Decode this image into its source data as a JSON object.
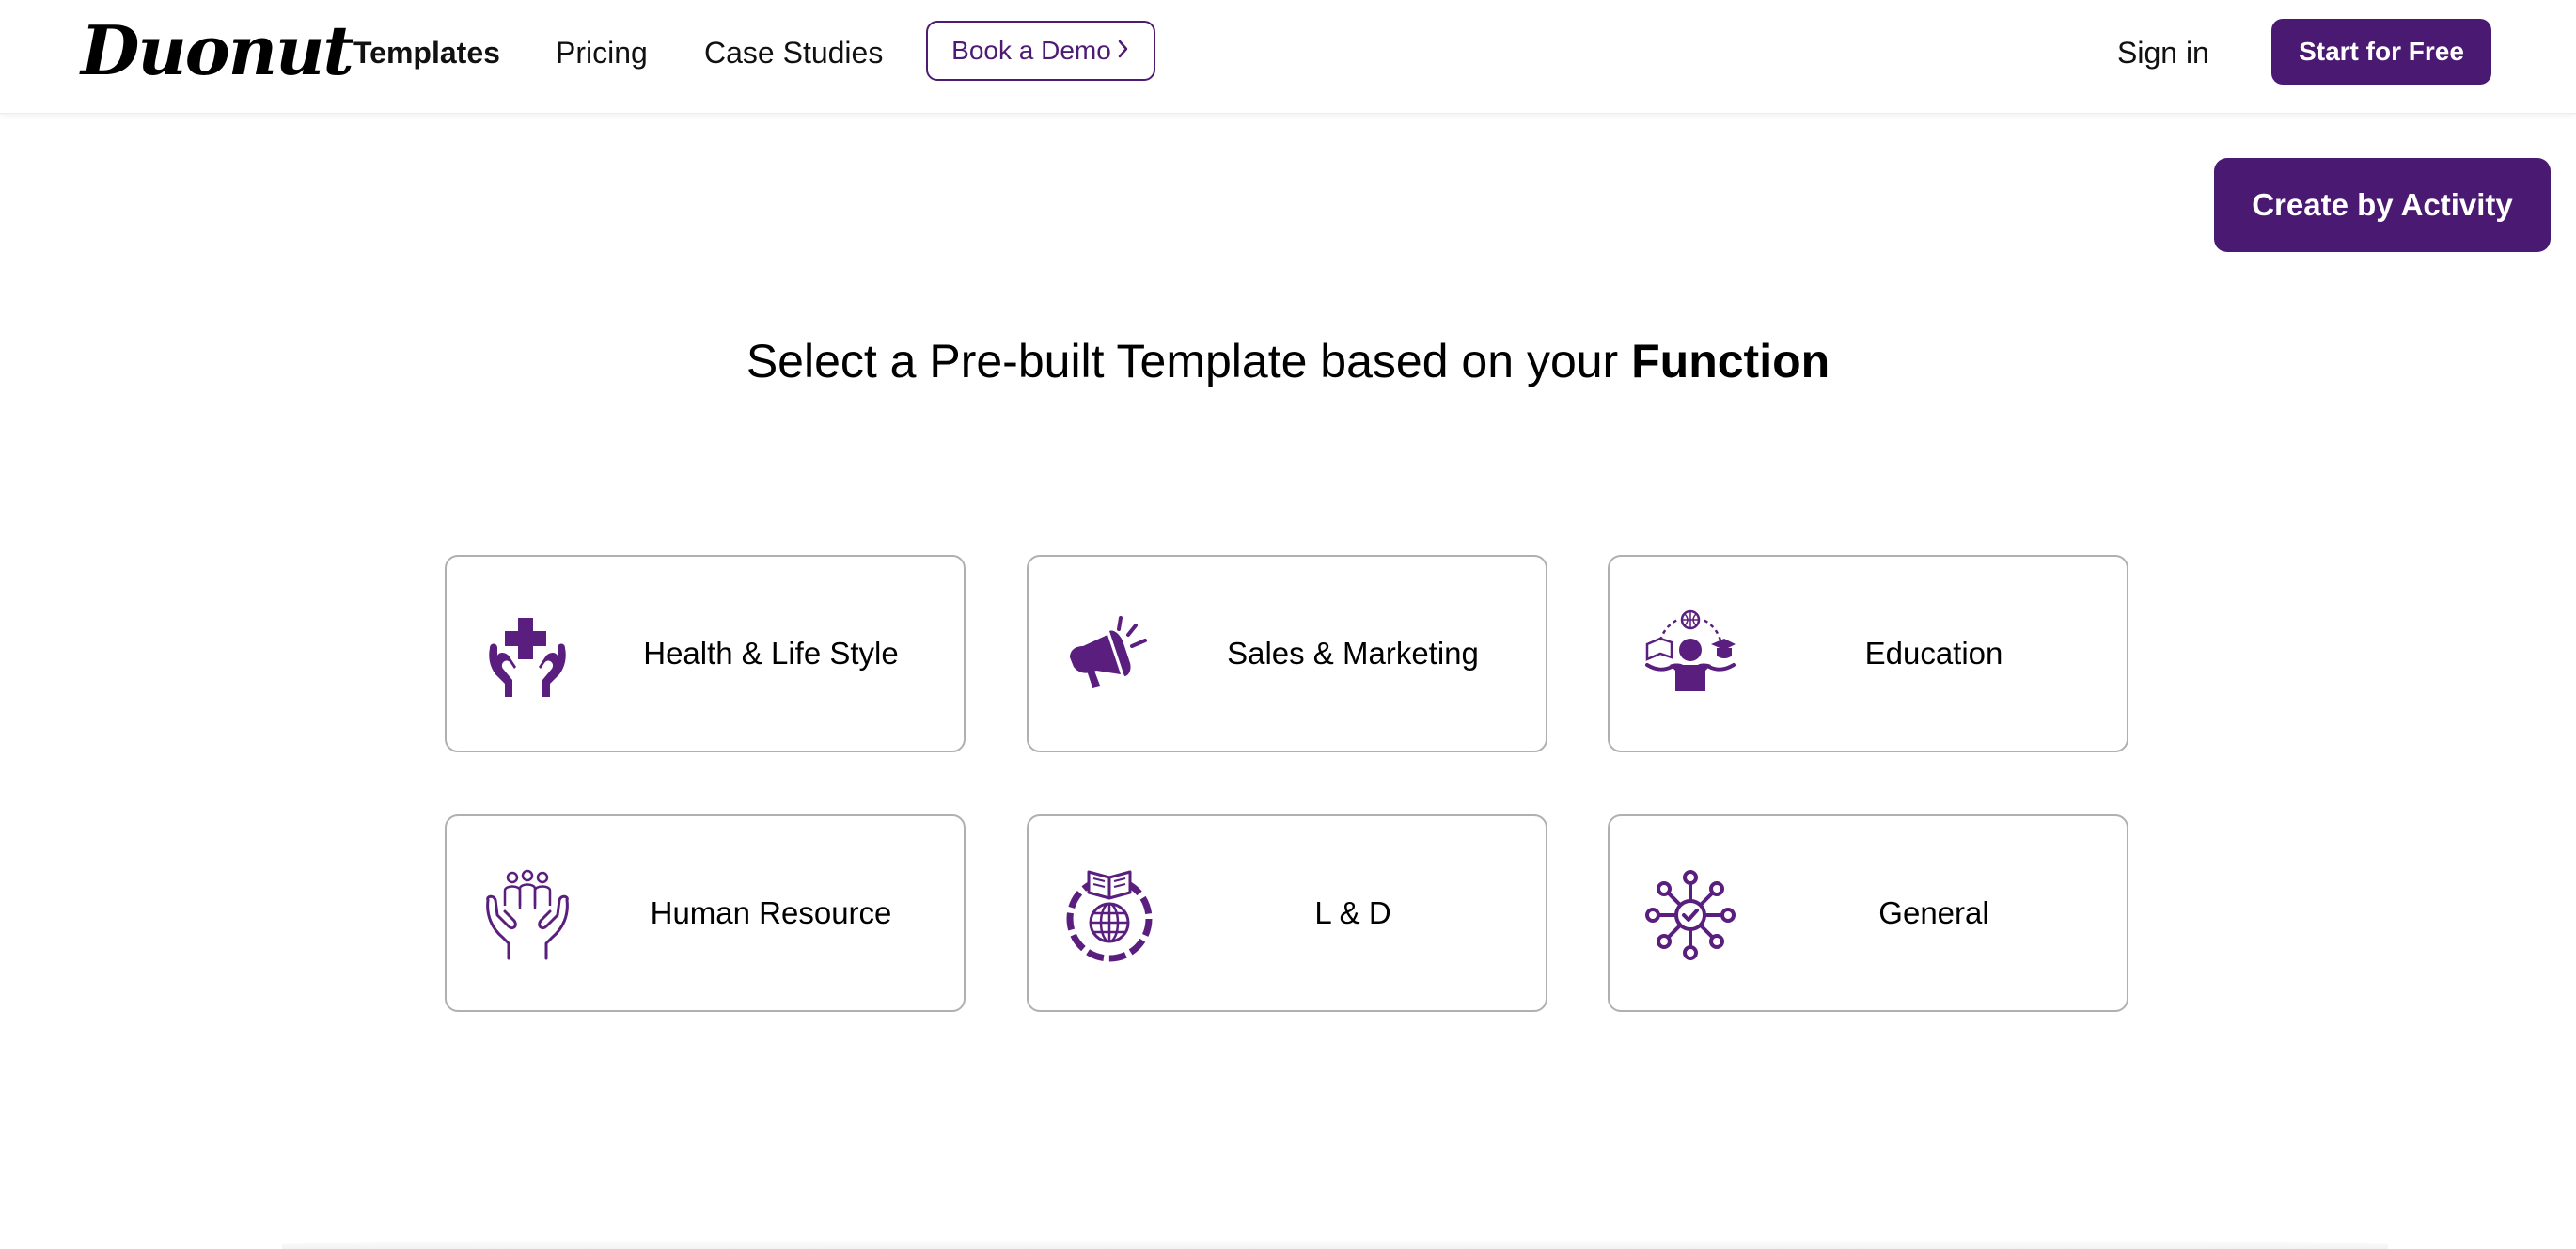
{
  "brand": {
    "logo_text": "Duonut",
    "accent_color": "#4a1a73"
  },
  "nav": {
    "links": [
      {
        "label": "Templates",
        "active": true
      },
      {
        "label": "Pricing",
        "active": false
      },
      {
        "label": "Case Studies",
        "active": false
      }
    ],
    "demo_label": "Book a Demo",
    "demo_icon": "chevron-right-icon",
    "signin_label": "Sign in",
    "start_label": "Start for Free"
  },
  "activity_button_label": "Create by Activity",
  "heading": {
    "prefix": "Select a Pre-built Template based on your ",
    "emphasis": "Function"
  },
  "categories": [
    {
      "label": "Health & Life Style",
      "icon": "health-hands-cross-icon"
    },
    {
      "label": "Sales & Marketing",
      "icon": "megaphone-icon"
    },
    {
      "label": "Education",
      "icon": "education-student-icon"
    },
    {
      "label": "Human Resource",
      "icon": "people-in-hands-icon"
    },
    {
      "label": "L & D",
      "icon": "book-globe-icon"
    },
    {
      "label": "General",
      "icon": "network-check-icon"
    }
  ]
}
